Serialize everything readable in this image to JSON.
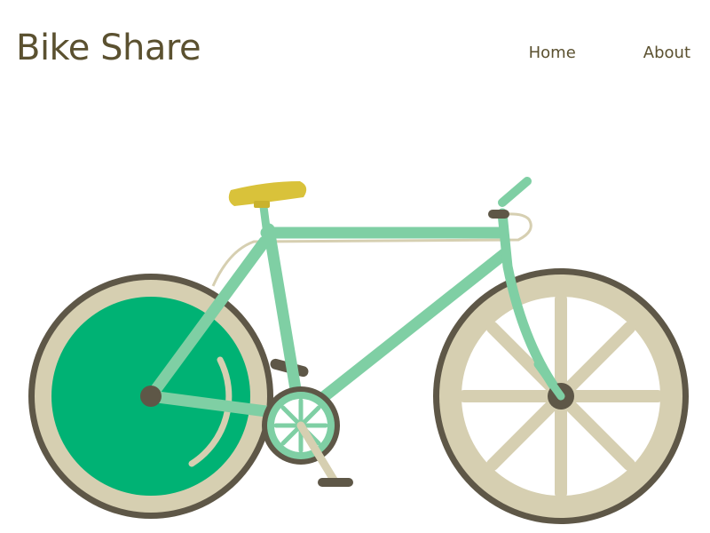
{
  "site": {
    "title": "Bike Share"
  },
  "nav": {
    "items": [
      {
        "label": "Home"
      },
      {
        "label": "About"
      }
    ]
  },
  "hero": {
    "image_icon": "bicycle-illustration-icon"
  },
  "colors": {
    "text": "#5b5130",
    "frame": "#7fcfa4",
    "rear_wheel_fill": "#00b274",
    "tire": "#5e5747",
    "rim": "#d6cfb1",
    "saddle": "#d9c23a",
    "background": "#ffffff"
  }
}
